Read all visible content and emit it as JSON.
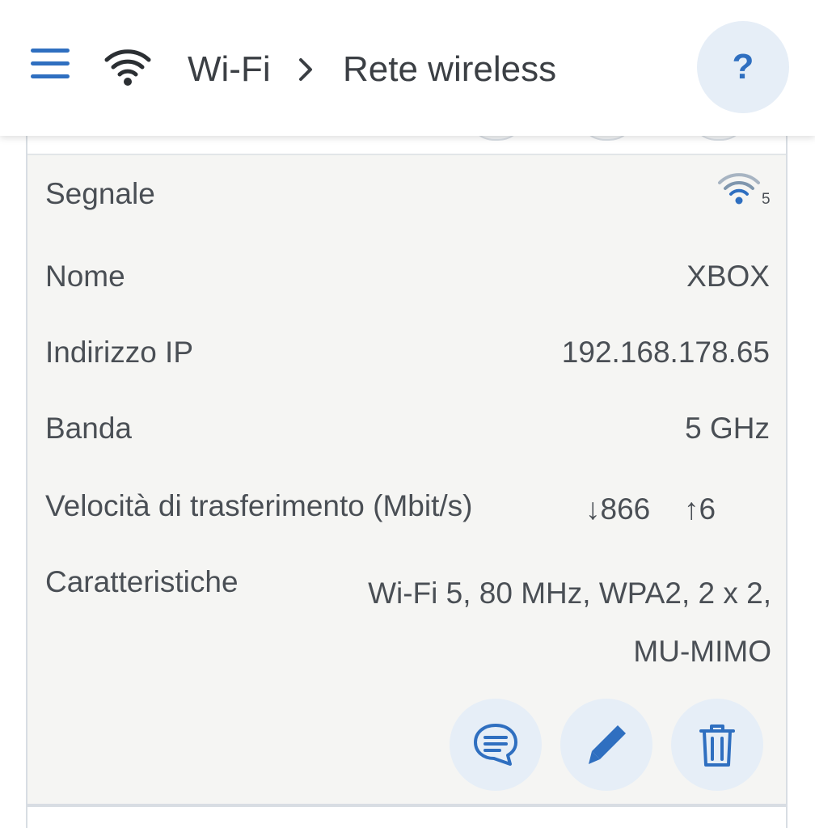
{
  "header": {
    "breadcrumb": {
      "parent": "Wi-Fi",
      "current": "Rete wireless"
    },
    "help_label": "?",
    "accent_color": "#2f6fc0"
  },
  "device": {
    "rows": {
      "signal": {
        "label": "Segnale",
        "level": "5"
      },
      "name": {
        "label": "Nome",
        "value": "XBOX"
      },
      "ip": {
        "label": "Indirizzo IP",
        "value": "192.168.178.65"
      },
      "band": {
        "label": "Banda",
        "value": "5 GHz"
      },
      "speed": {
        "label": "Velocità di trasferimento (Mbit/s)",
        "down": "↓866",
        "up": "↑6"
      },
      "features": {
        "label": "Caratteristiche",
        "value": "Wi-Fi 5, 80 MHz, WPA2, 2 x 2, MU-MIMO"
      }
    },
    "actions": [
      "message-icon",
      "pencil-icon",
      "trash-icon"
    ]
  }
}
